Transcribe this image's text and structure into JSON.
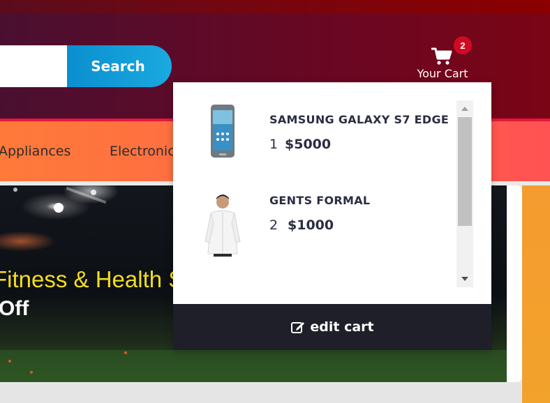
{
  "header": {
    "search": {
      "button_label": "Search",
      "placeholder": ""
    },
    "cart": {
      "count": "2",
      "label": "Your Cart",
      "icon": "shopping-cart-icon"
    }
  },
  "nav": {
    "items": [
      "Appliances",
      "Electronics"
    ]
  },
  "hero": {
    "title": "Fitness & Health Supplements",
    "subtitle": "Off"
  },
  "cart_dropdown": {
    "items": [
      {
        "name": "SAMSUNG GALAXY S7 EDGE",
        "qty": "1",
        "price": "$5000",
        "thumb": "phone-image"
      },
      {
        "name": "GENTS FORMAL",
        "qty": "2",
        "price": "$1000",
        "thumb": "shirt-image"
      }
    ],
    "edit_label": "edit cart",
    "edit_icon": "edit-icon"
  },
  "colors": {
    "accent_blue": "#1aa9e0",
    "badge_red": "#d10a24",
    "header_dark": "#6e0620",
    "nav_orange": "#ff6b45",
    "footer_dark": "#1e1f29"
  }
}
